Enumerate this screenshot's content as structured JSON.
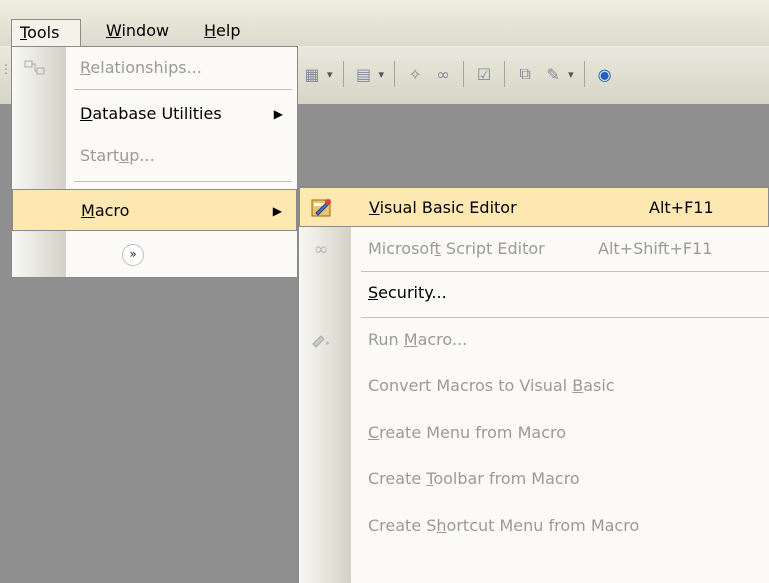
{
  "menubar": {
    "items": [
      {
        "pre": "",
        "ul": "T",
        "post": "ools"
      },
      {
        "pre": "",
        "ul": "W",
        "post": "indow"
      },
      {
        "pre": "",
        "ul": "H",
        "post": "elp"
      }
    ]
  },
  "tools_menu": {
    "items": [
      {
        "pre": "",
        "ul": "R",
        "post": "elationships...",
        "icon": "relationships-icon",
        "enabled": false
      },
      {
        "pre": "",
        "ul": "D",
        "post": "atabase Utilities",
        "submenu": true,
        "enabled": true
      },
      {
        "pre": "Start",
        "ul": "u",
        "post": "p...",
        "enabled": false
      },
      {
        "pre": "",
        "ul": "M",
        "post": "acro",
        "submenu": true,
        "enabled": true,
        "highlighted": true
      }
    ],
    "expand_glyph": "»"
  },
  "macro_menu": {
    "items": [
      {
        "pre": "",
        "ul": "V",
        "post": "isual Basic Editor",
        "shortcut": "Alt+F11",
        "icon": "visual-basic-editor-icon",
        "enabled": true,
        "highlighted": true
      },
      {
        "pre": "Microsof",
        "ul": "t",
        "post": " Script Editor",
        "shortcut": "Alt+Shift+F11",
        "icon": "script-editor-icon",
        "enabled": false
      },
      {
        "pre": "",
        "ul": "S",
        "post": "ecurity...",
        "enabled": true
      },
      {
        "pre": "Run ",
        "ul": "M",
        "post": "acro...",
        "icon": "run-macro-icon",
        "enabled": false
      },
      {
        "pre": "Convert Macros to Visual ",
        "ul": "B",
        "post": "asic",
        "enabled": false
      },
      {
        "pre": "",
        "ul": "C",
        "post": "reate Menu from Macro",
        "enabled": false
      },
      {
        "pre": "Create ",
        "ul": "T",
        "post": "oolbar from Macro",
        "enabled": false
      },
      {
        "pre": "Create S",
        "ul": "h",
        "post": "ortcut Menu from Macro",
        "enabled": false
      }
    ]
  },
  "colors": {
    "highlight": "#fde8b2",
    "disabled_text": "#9a9a9a",
    "background": "#8f8f8f"
  }
}
